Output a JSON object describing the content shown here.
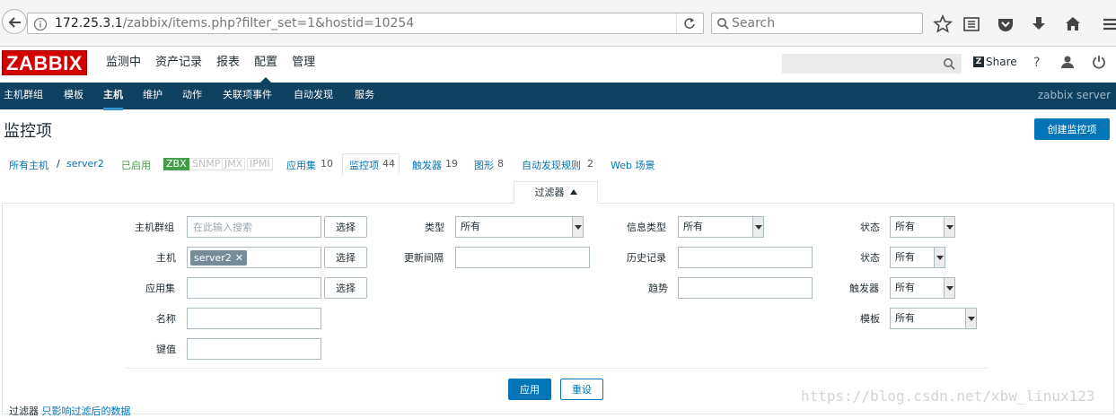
{
  "browser": {
    "url_host": "172.25.3.1",
    "url_path": "/zabbix/items.php?filter_set=1&hostid=10254",
    "search_placeholder": "Search"
  },
  "header": {
    "logo": "ZABBIX",
    "menu": [
      "监测中",
      "资产记录",
      "报表",
      "配置",
      "管理"
    ],
    "selected_menu": "配置",
    "share": "Share",
    "help": "?"
  },
  "subnav": {
    "items": [
      "主机群组",
      "模板",
      "主机",
      "维护",
      "动作",
      "关联项事件",
      "自动发现",
      "服务"
    ],
    "selected": "主机",
    "server_name": "zabbix server"
  },
  "page": {
    "title": "监控项",
    "create_button": "创建监控项"
  },
  "breadcrumb": {
    "all_hosts": "所有主机",
    "separator": "/",
    "host": "server2",
    "status": "已启用",
    "availability": [
      "ZBX",
      "SNMP",
      "JMX",
      "IPMI"
    ],
    "tabs": [
      {
        "label": "应用集",
        "count": "10"
      },
      {
        "label": "监控项",
        "count": "44"
      },
      {
        "label": "触发器",
        "count": "19"
      },
      {
        "label": "图形",
        "count": "8"
      },
      {
        "label": "自动发现规则",
        "count": "2"
      },
      {
        "label": "Web 场景",
        "count": ""
      }
    ]
  },
  "filter": {
    "tab_label": "过滤器",
    "host_group_label": "主机群组",
    "host_group_placeholder": "在此输入搜索",
    "select_label": "选择",
    "host_label": "主机",
    "host_chip": "server2",
    "app_label": "应用集",
    "name_label": "名称",
    "key_label": "键值",
    "type_label": "类型",
    "type_value": "所有",
    "interval_label": "更新间隔",
    "info_type_label": "信息类型",
    "info_type_value": "所有",
    "history_label": "历史记录",
    "trend_label": "趋势",
    "state_label": "状态",
    "state_value": "所有",
    "status_label": "状态",
    "status_value": "所有",
    "trigger_label": "触发器",
    "trigger_value": "所有",
    "template_label": "模板",
    "template_value": "所有",
    "apply": "应用",
    "reset": "重设"
  },
  "footer": {
    "prefix": "过滤器",
    "link": "只影响过滤后的数据"
  },
  "watermark": "https://blog.csdn.net/xbw_linux123"
}
